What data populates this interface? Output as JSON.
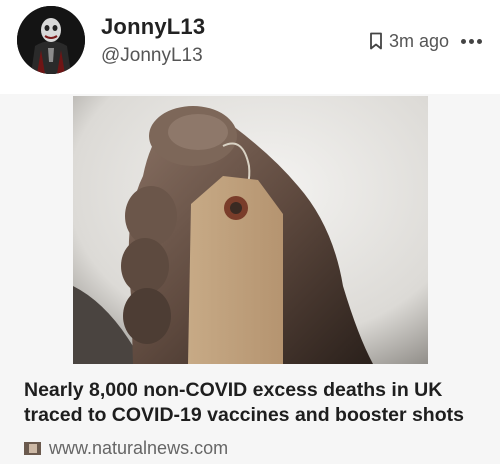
{
  "post": {
    "author": {
      "display_name": "JonnyL13",
      "handle": "@JonnyL13"
    },
    "timestamp": "3m ago",
    "icons": {
      "bookmark": "bookmark-icon",
      "more": "more-icon"
    },
    "link_preview": {
      "headline": "Nearly 8,000 non-COVID excess deaths in UK traced to COVID-19 vaccines and booster shots",
      "domain": "www.naturalnews.com"
    }
  }
}
